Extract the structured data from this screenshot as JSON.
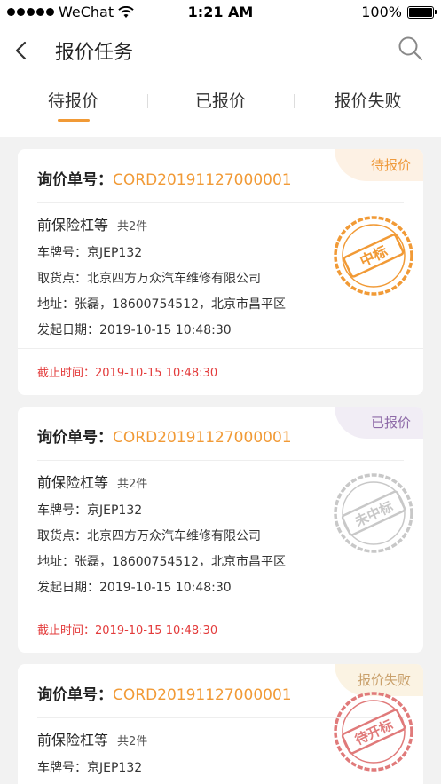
{
  "status_bar": {
    "carrier": "WeChat",
    "time": "1:21 AM",
    "battery": "100%"
  },
  "nav": {
    "title": "报价任务"
  },
  "tabs": [
    {
      "label": "待报价",
      "active": true
    },
    {
      "label": "已报价",
      "active": false
    },
    {
      "label": "报价失败",
      "active": false
    }
  ],
  "labels": {
    "order": "询价单号：",
    "plate": "车牌号：",
    "pickup": "取货点：",
    "address": "地址：",
    "date": "发起日期：",
    "deadline": "截止时间："
  },
  "cards": [
    {
      "badge": "待报价",
      "order_no": "CORD20191127000001",
      "part": "前保险杠等",
      "count": "共2件",
      "plate": "京JEP132",
      "pickup": "北京四方万众汽车维修有限公司",
      "address": "张磊，18600754512，北京市昌平区",
      "date": "2019-10-15 10:48:30",
      "deadline": "2019-10-15 10:48:30",
      "stamp": {
        "text": "中标",
        "color": "#f19a36"
      }
    },
    {
      "badge": "已报价",
      "order_no": "CORD20191127000001",
      "part": "前保险杠等",
      "count": "共2件",
      "plate": "京JEP132",
      "pickup": "北京四方万众汽车维修有限公司",
      "address": "张磊，18600754512，北京市昌平区",
      "date": "2019-10-15 10:48:30",
      "deadline": "2019-10-15 10:48:30",
      "stamp": {
        "text": "未中标",
        "color": "#c8c8c8"
      }
    },
    {
      "badge": "报价失败",
      "order_no": "CORD20191127000001",
      "part": "前保险杠等",
      "count": "共2件",
      "plate": "京JEP132",
      "stamp": {
        "text": "待开标",
        "color": "#e07a7a"
      }
    }
  ],
  "icons": {
    "back": "back-icon",
    "search": "search-icon",
    "wifi": "wifi-icon",
    "battery": "battery-icon"
  },
  "colors": {
    "accent": "#f19a36",
    "deadline": "#e33b3b"
  }
}
